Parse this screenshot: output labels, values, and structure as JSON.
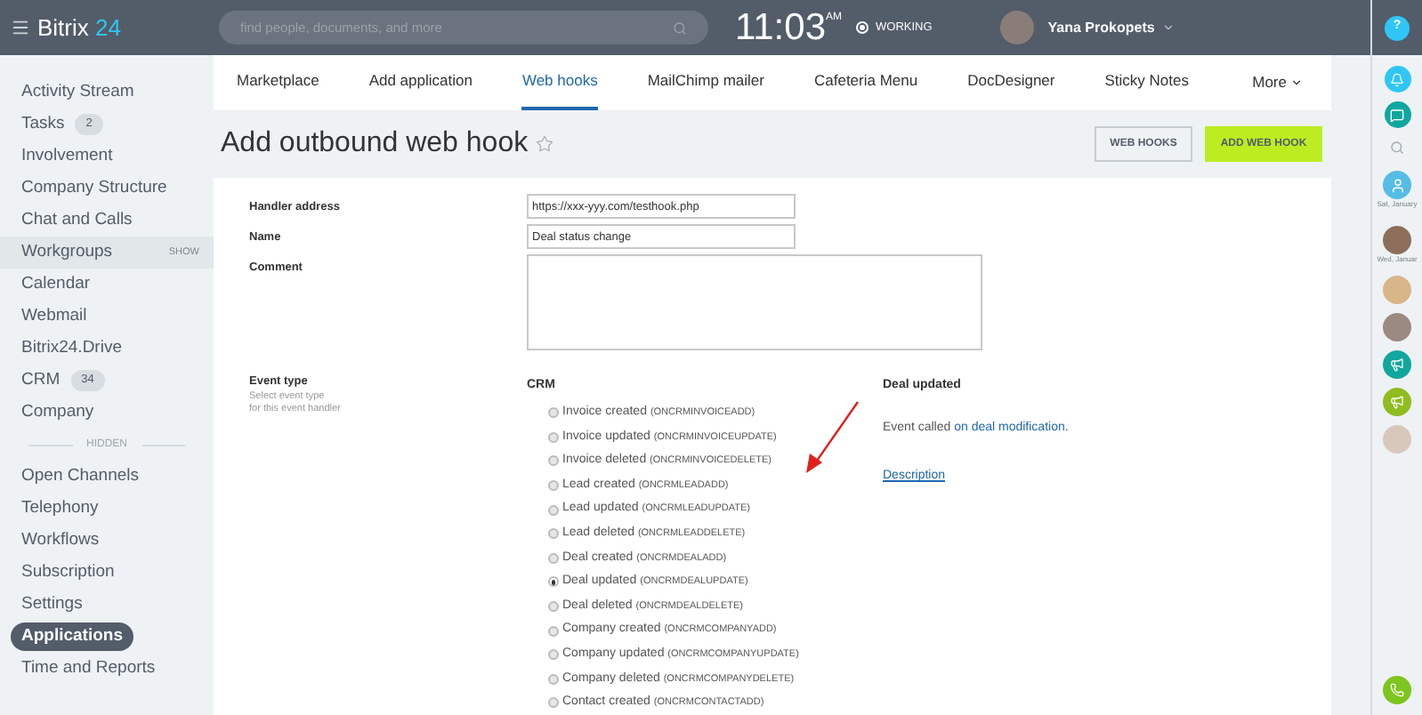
{
  "header": {
    "logo_text": "Bitrix",
    "logo_number": "24",
    "search_placeholder": "find people, documents, and more",
    "time": "11:03",
    "time_suffix": "AM",
    "status": "WORKING",
    "user_name": "Yana Prokopets"
  },
  "sidebar": {
    "items": [
      {
        "kind": "link",
        "label": "Activity Stream",
        "selected": false
      },
      {
        "kind": "link",
        "label": "Tasks",
        "badge": "2",
        "selected": false
      },
      {
        "kind": "link",
        "label": "Involvement",
        "selected": false
      },
      {
        "kind": "link",
        "label": "Company Structure",
        "selected": false
      },
      {
        "kind": "link",
        "label": "Chat and Calls",
        "selected": false
      },
      {
        "kind": "link",
        "label": "Workgroups",
        "action": "SHOW",
        "selected": false
      },
      {
        "kind": "link",
        "label": "Calendar",
        "selected": false
      },
      {
        "kind": "link",
        "label": "Webmail",
        "selected": false
      },
      {
        "kind": "link",
        "label": "Bitrix24.Drive",
        "selected": false
      },
      {
        "kind": "link",
        "label": "CRM",
        "badge": "34",
        "selected": false
      },
      {
        "kind": "link",
        "label": "Company",
        "selected": false
      },
      {
        "kind": "divider",
        "label": "HIDDEN"
      },
      {
        "kind": "link",
        "label": "Open Channels",
        "selected": false
      },
      {
        "kind": "link",
        "label": "Telephony",
        "selected": false
      },
      {
        "kind": "link",
        "label": "Workflows",
        "selected": false
      },
      {
        "kind": "link",
        "label": "Subscription",
        "selected": false
      },
      {
        "kind": "link",
        "label": "Settings",
        "selected": false
      },
      {
        "kind": "link",
        "label": "Applications",
        "selected": true
      },
      {
        "kind": "link",
        "label": "Time and Reports",
        "selected": false
      }
    ]
  },
  "tabs": [
    {
      "label": "Marketplace",
      "selected": false
    },
    {
      "label": "Add application",
      "selected": false
    },
    {
      "label": "Web hooks",
      "selected": true
    },
    {
      "label": "MailChimp mailer",
      "selected": false
    },
    {
      "label": "Cafeteria Menu",
      "selected": false
    },
    {
      "label": "DocDesigner",
      "selected": false
    },
    {
      "label": "Sticky Notes",
      "selected": false
    }
  ],
  "more_tab": "More",
  "page_title": "Add outbound web hook",
  "buttons": [
    {
      "kind": "secondary",
      "label": "WEB HOOKS"
    },
    {
      "kind": "primary",
      "label": "ADD WEB HOOK"
    }
  ],
  "form": {
    "fields": [
      {
        "kind": "input",
        "label": "Handler address",
        "value": "https://xxx-yyy.com/testhook.php"
      },
      {
        "kind": "input",
        "label": "Name",
        "value": "Deal status change"
      },
      {
        "kind": "textarea",
        "label": "Comment"
      }
    ],
    "event_type": {
      "label": "Event type",
      "hint_lines": [
        "Select event type",
        "for this event handler"
      ],
      "group": "CRM",
      "events": [
        {
          "label": "Invoice created",
          "code": "(ONCRMINVOICEADD)",
          "selected": false
        },
        {
          "label": "Invoice updated",
          "code": "(ONCRMINVOICEUPDATE)",
          "selected": false
        },
        {
          "label": "Invoice deleted",
          "code": "(ONCRMINVOICEDELETE)",
          "selected": false
        },
        {
          "label": "Lead created",
          "code": "(ONCRMLEADADD)",
          "selected": false
        },
        {
          "label": "Lead updated",
          "code": "(ONCRMLEADUPDATE)",
          "selected": false
        },
        {
          "label": "Lead deleted",
          "code": "(ONCRMLEADDELETE)",
          "selected": false
        },
        {
          "label": "Deal created",
          "code": "(ONCRMDEALADD)",
          "selected": false
        },
        {
          "label": "Deal updated",
          "code": "(ONCRMDEALUPDATE)",
          "selected": true
        },
        {
          "label": "Deal deleted",
          "code": "(ONCRMDEALDELETE)",
          "selected": false
        },
        {
          "label": "Company created",
          "code": "(ONCRMCOMPANYADD)",
          "selected": false
        },
        {
          "label": "Company updated",
          "code": "(ONCRMCOMPANYUPDATE)",
          "selected": false
        },
        {
          "label": "Company deleted",
          "code": "(ONCRMCOMPANYDELETE)",
          "selected": false
        },
        {
          "label": "Contact created",
          "code": "(ONCRMCONTACTADD)",
          "selected": false
        }
      ],
      "details": {
        "title": "Deal updated",
        "text": "Event called",
        "link": "on deal modification",
        "text_end": ".",
        "description_link": "Description"
      }
    }
  },
  "right_bar": {
    "help": "?",
    "recent": [
      {
        "label": "Sat, January",
        "kind": "generic"
      },
      {
        "label": "Wed, Januar",
        "kind": "photo"
      }
    ]
  }
}
